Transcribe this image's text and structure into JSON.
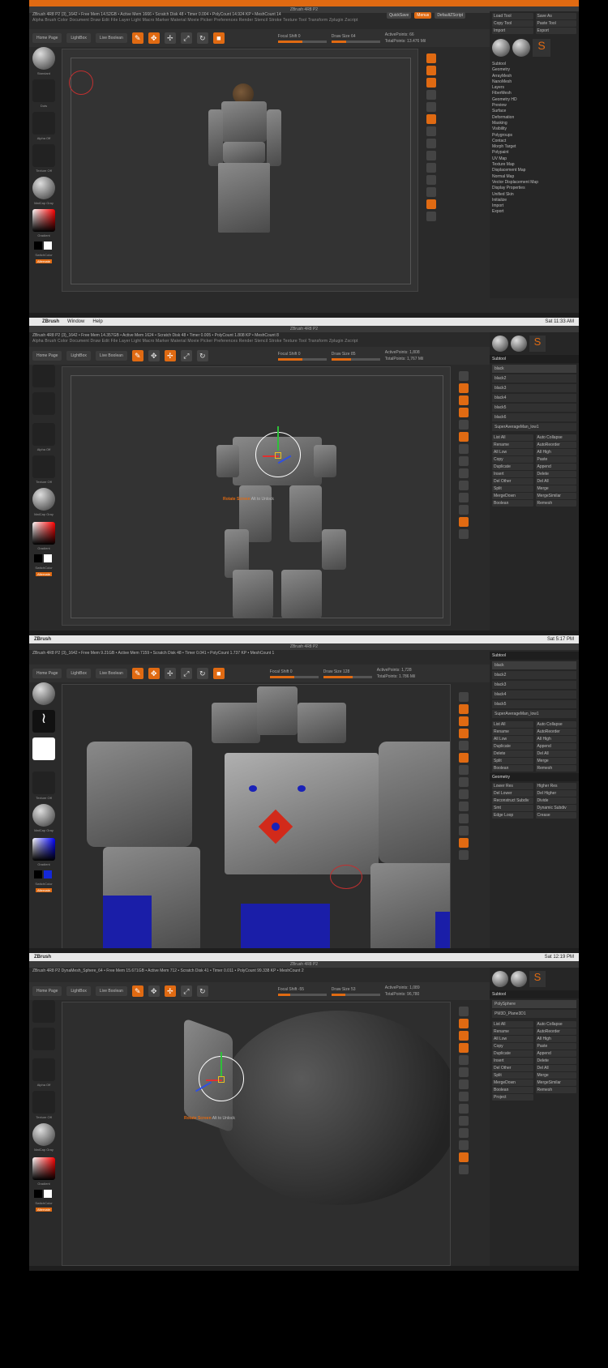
{
  "shot1": {
    "title": "ZBrush 4R8 P2",
    "info": "ZBrush 4R8 P2 (3)_1642  • Free Mem 14.52GB • Active Mem 1666 • Scratch Disk 48 • Timer 0.004 • PolyCount 14.924 KP • MeshCount 14",
    "menus": "Alpha  Brush  Color  Document  Draw  Edit  File  Layer  Light  Macro  Marker  Material  Movie  Picker  Preferences  Render  Stencil  Stroke  Texture  Tool  Transform  Zplugin  Zscript",
    "quicksave": "QuickSave",
    "default_script": "DefaultZScript",
    "menu_label": "Menus",
    "home_page": "Home Page",
    "lightbox": "LightBox",
    "live_boolean": "Live Boolean",
    "focal_shift": "Focal Shift 0",
    "draw_size": "Draw Size 64",
    "active_points": "ActivePoints: 66",
    "total_points": "TotalPoints: 13.476 Mil",
    "tool_items": [
      "Subtool",
      "Geometry",
      "ArrayMesh",
      "NanoMesh",
      "Layers",
      "FiberMesh",
      "Geometry HD",
      "Preview",
      "Surface",
      "Deformation",
      "Masking",
      "Visibility",
      "Polygroups",
      "Contact",
      "Morph Target",
      "Polypaint",
      "UV Map",
      "Texture Map",
      "Displacement Map",
      "Normal Map",
      "Vector Displacement Map",
      "Display Properties",
      "Unified Skin",
      "Initialize",
      "Import",
      "Export"
    ]
  },
  "shot2": {
    "mac_app": "ZBrush",
    "mac_menu1": "Window",
    "mac_menu2": "Help",
    "clock": "Sat 11:33 AM",
    "title": "ZBrush 4R8 P2",
    "info": "ZBrush 4R8 P2 (3)_1642  • Free Mem 14.357GB • Active Mem 1624 • Scratch Disk 48 • Timer 0.005 • PolyCount 1.808 KP • MeshCount 8",
    "menus": "Alpha  Brush  Color  Document  Draw  Edit  File  Layer  Light  Macro  Marker  Material  Movie  Picker  Preferences  Render  Stencil  Stroke  Texture  Tool  Transform  Zplugin  Zscript",
    "home_page": "Home Page",
    "lightbox": "LightBox",
    "live_boolean": "Live Boolean",
    "focal_shift": "Focal Shift 0",
    "draw_size": "Draw Size 85",
    "active_points": "ActivePoints: 1,808",
    "total_points": "TotalPoints: 1,767 Mil",
    "hint_prefix": "Rotate Screen",
    "hint_suffix": "Alt to Unlock",
    "subtool_title": "Subtool",
    "subtools": [
      "black",
      "black2",
      "black3",
      "black4",
      "black5",
      "black6",
      "SuperAverageMan_low1"
    ],
    "buttons": [
      "List All",
      "Auto Collapse",
      "Rename",
      "AutoReorder",
      "All Low",
      "All High",
      "Copy",
      "Paste",
      "Duplicate",
      "Append",
      "Insert",
      "Delete",
      "Del Other",
      "Del All",
      "Split",
      "Merge",
      "MergeDown",
      "MergeSimilar",
      "Boolean",
      "Remesh"
    ]
  },
  "shot3": {
    "mac_app": "ZBrush",
    "clock": "Sat 5:17 PM",
    "title": "ZBrush 4R8 P2",
    "info": "ZBrush 4R8 P2 (3)_1642  • Free Mem 9.21GB • Active Mem 7159 • Scratch Disk 48 • Timer 0.041 • PolyCount 1.737 KP • MeshCount 1",
    "home_page": "Home Page",
    "lightbox": "LightBox",
    "live_boolean": "Live Boolean",
    "focal_shift": "Focal Shift 0",
    "draw_size": "Draw Size 128",
    "active_points": "ActivePoints: 1,728",
    "total_points": "TotalPoints: 1.786 Mil",
    "subtools": [
      "black",
      "black2",
      "black3",
      "black4",
      "black5",
      "SuperAverageMan_low1"
    ],
    "geometry_title": "Geometry",
    "geometry_items": [
      "Lower Res",
      "Higher Res",
      "Del Lower",
      "Del Higher",
      "Reconstruct Subdiv",
      "Divide",
      "Smt",
      "Dynamic Subdiv",
      "Edge Loop",
      "Crease"
    ]
  },
  "shot4": {
    "mac_app": "ZBrush",
    "clock": "Sat 12:19 PM",
    "title": "ZBrush 4R8 P2",
    "info": "ZBrush 4R8 P2 DynaMesh_Sphere_64  • Free Mem 15.671GB • Active Mem 712 • Scratch Disk 41 • Timer 0.011 • PolyCount 99.338 KP • MeshCount 2",
    "home_page": "Home Page",
    "lightbox": "LightBox",
    "live_boolean": "Live Boolean",
    "focal_shift": "Focal Shift -55",
    "draw_size": "Draw Size 53",
    "active_points": "ActivePoints: 1,089",
    "total_points": "TotalPoints: 96,780",
    "hint_prefix": "Rotate Screen",
    "hint_suffix": "Alt to Unlock",
    "subtools": [
      "PolySphere",
      "PM3D_Plane3D1"
    ],
    "buttons": [
      "List All",
      "Auto Collapse",
      "Rename",
      "AutoReorder",
      "All Low",
      "All High",
      "Copy",
      "Paste",
      "Duplicate",
      "Append",
      "Insert",
      "Delete",
      "Del Other",
      "Del All",
      "Split",
      "Merge",
      "MergeDown",
      "MergeSimilar",
      "Boolean",
      "Remesh",
      "Project"
    ]
  },
  "shelf": {
    "standard": "Standard",
    "dots": "Dots",
    "alpha_off": "Alpha Off",
    "texture_off": "Texture Off",
    "matcap": "MatCap Gray",
    "gradient": "Gradient",
    "switch_color": "SwitchColor",
    "alternate": "Alternate"
  },
  "colors": {
    "accent": "#e06a12",
    "ui_bg": "#2a2a2a",
    "viewport_bg": "#333333"
  }
}
